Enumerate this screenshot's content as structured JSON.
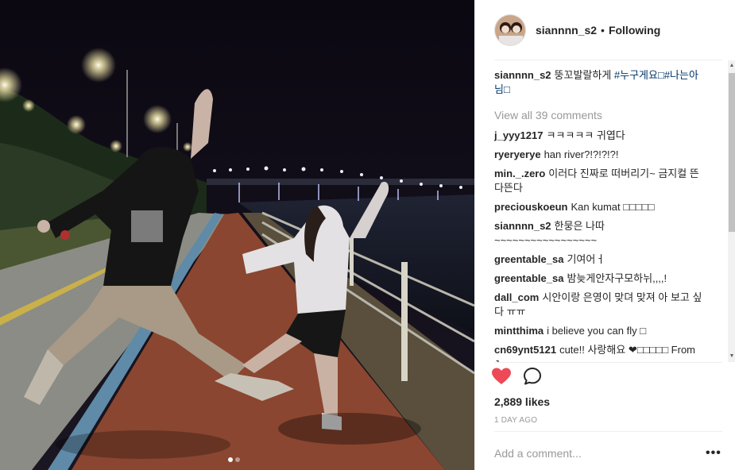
{
  "post": {
    "photo_alt": "",
    "carousel": {
      "count": 2,
      "active_index": 0
    }
  },
  "header": {
    "username": "siannnn_s2",
    "separator": "•",
    "follow_status": "Following"
  },
  "caption": {
    "username": "siannnn_s2",
    "text": "뚱꼬발랄하게 ",
    "hashtags": "#누구게요□#나는아님□"
  },
  "view_all_label": "View all 39 comments",
  "comments": [
    {
      "user": "j_yyy1217",
      "text": "ㅋㅋㅋㅋㅋ 귀엽다"
    },
    {
      "user": "ryeryerye",
      "text": "han river?!?!?!?!"
    },
    {
      "user": "min._.zero",
      "text": "이러다 진짜로 떠버리기~ 금지컬 뜬다뜬다"
    },
    {
      "user": "preciouskoeun",
      "text": "Kan kumat □□□□□"
    },
    {
      "user": "siannnn_s2",
      "text": "한뭉은 나따 ~~~~~~~~~~~~~~~~~"
    },
    {
      "user": "greentable_sa",
      "text": "기여어ㅓ"
    },
    {
      "user": "greentable_sa",
      "text": "밤늦게안자구모하뉘,,,,!"
    },
    {
      "user": "dall_com",
      "text": "시안이랑 은영이 맞뎌 맞져 아 보고 싶다 ㅠㅠ"
    },
    {
      "user": "mintthima",
      "text": "i believe you can fly □"
    },
    {
      "user": "cn69ynt5121",
      "text": "cute!! 사랑해요 ❤□□□□□ From Japan"
    }
  ],
  "actions": {
    "like_icon": "heart-icon",
    "comment_icon": "comment-icon",
    "like_color": "#ed4956"
  },
  "likes_label": "2,889 likes",
  "timestamp": "1 DAY AGO",
  "add_comment": {
    "placeholder": "Add a comment...",
    "value": ""
  },
  "more_label": "•••",
  "scrollbar": {
    "up": "▲",
    "down": "▼"
  }
}
